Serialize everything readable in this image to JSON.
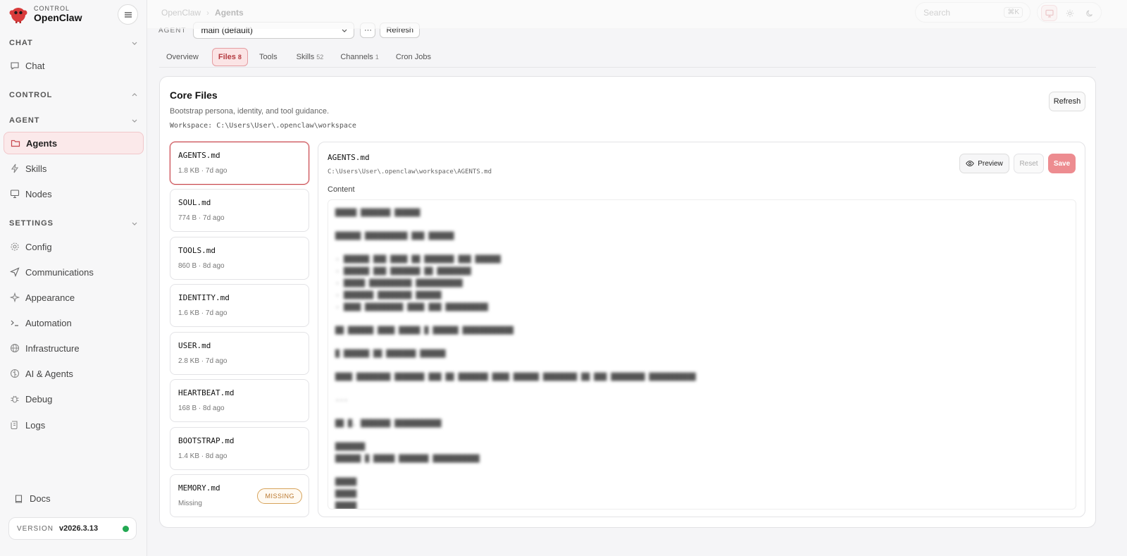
{
  "brand": {
    "small": "CONTROL",
    "name": "OpenClaw"
  },
  "sidebar": {
    "sections": {
      "chat": "CHAT",
      "control": "CONTROL",
      "agent": "AGENT",
      "settings": "SETTINGS"
    },
    "items": {
      "chat": "Chat",
      "agents": "Agents",
      "skills": "Skills",
      "nodes": "Nodes",
      "config": "Config",
      "communications": "Communications",
      "appearance": "Appearance",
      "automation": "Automation",
      "infrastructure": "Infrastructure",
      "ai_agents": "AI & Agents",
      "debug": "Debug",
      "logs": "Logs"
    },
    "docs": "Docs",
    "version_label": "VERSION",
    "version": "v2026.3.13"
  },
  "topbar": {
    "breadcrumb_root": "OpenClaw",
    "breadcrumb_sep": "›",
    "breadcrumb_current": "Agents",
    "search_placeholder": "Search",
    "search_shortcut": "⌘K"
  },
  "agent_row": {
    "label": "AGENT",
    "selected": "main (default)",
    "more": "···",
    "refresh": "Refresh"
  },
  "tabs": [
    {
      "label": "Overview",
      "count": ""
    },
    {
      "label": "Files",
      "count": "8"
    },
    {
      "label": "Tools",
      "count": ""
    },
    {
      "label": "Skills",
      "count": "52"
    },
    {
      "label": "Channels",
      "count": "1"
    },
    {
      "label": "Cron Jobs",
      "count": ""
    }
  ],
  "core_files": {
    "title": "Core Files",
    "description": "Bootstrap persona, identity, and tool guidance.",
    "workspace": "Workspace: C:\\Users\\User\\.openclaw\\workspace",
    "refresh": "Refresh"
  },
  "files": [
    {
      "name": "AGENTS.md",
      "meta": "1.8 KB · 7d ago"
    },
    {
      "name": "SOUL.md",
      "meta": "774 B · 7d ago"
    },
    {
      "name": "TOOLS.md",
      "meta": "860 B · 8d ago"
    },
    {
      "name": "IDENTITY.md",
      "meta": "1.6 KB · 7d ago"
    },
    {
      "name": "USER.md",
      "meta": "2.8 KB · 7d ago"
    },
    {
      "name": "HEARTBEAT.md",
      "meta": "168 B · 8d ago"
    },
    {
      "name": "BOOTSTRAP.md",
      "meta": "1.4 KB · 8d ago"
    },
    {
      "name": "MEMORY.md",
      "meta": "Missing",
      "badge": "MISSING"
    }
  ],
  "editor": {
    "file_name": "AGENTS.md",
    "path": "C:\\Users\\User\\.openclaw\\workspace\\AGENTS.md",
    "content_label": "Content",
    "preview": "Preview",
    "reset": "Reset",
    "save": "Save"
  },
  "colors": {
    "accent": "#c6464c",
    "accent_soft": "#fbe4e5",
    "save_button": "#ed8c90",
    "status_ok": "#22a852",
    "missing_badge": "#b9772d"
  }
}
